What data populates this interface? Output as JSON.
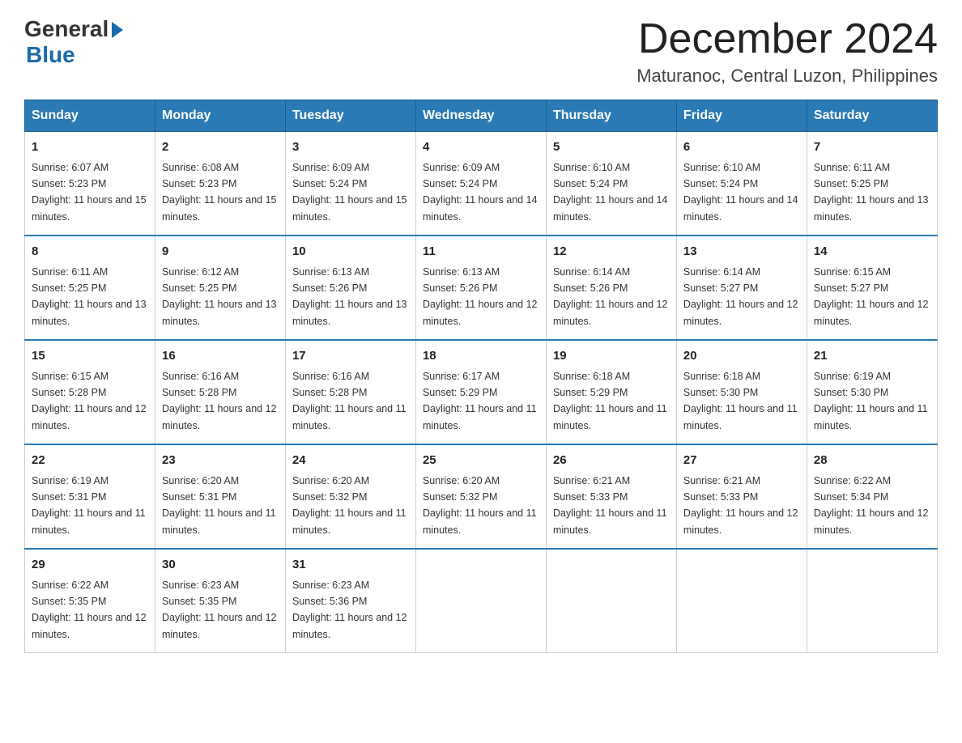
{
  "header": {
    "logo_general": "General",
    "logo_blue": "Blue",
    "month_year": "December 2024",
    "location": "Maturanoc, Central Luzon, Philippines"
  },
  "days_of_week": [
    "Sunday",
    "Monday",
    "Tuesday",
    "Wednesday",
    "Thursday",
    "Friday",
    "Saturday"
  ],
  "weeks": [
    [
      {
        "day": "1",
        "sunrise": "6:07 AM",
        "sunset": "5:23 PM",
        "daylight": "11 hours and 15 minutes."
      },
      {
        "day": "2",
        "sunrise": "6:08 AM",
        "sunset": "5:23 PM",
        "daylight": "11 hours and 15 minutes."
      },
      {
        "day": "3",
        "sunrise": "6:09 AM",
        "sunset": "5:24 PM",
        "daylight": "11 hours and 15 minutes."
      },
      {
        "day": "4",
        "sunrise": "6:09 AM",
        "sunset": "5:24 PM",
        "daylight": "11 hours and 14 minutes."
      },
      {
        "day": "5",
        "sunrise": "6:10 AM",
        "sunset": "5:24 PM",
        "daylight": "11 hours and 14 minutes."
      },
      {
        "day": "6",
        "sunrise": "6:10 AM",
        "sunset": "5:24 PM",
        "daylight": "11 hours and 14 minutes."
      },
      {
        "day": "7",
        "sunrise": "6:11 AM",
        "sunset": "5:25 PM",
        "daylight": "11 hours and 13 minutes."
      }
    ],
    [
      {
        "day": "8",
        "sunrise": "6:11 AM",
        "sunset": "5:25 PM",
        "daylight": "11 hours and 13 minutes."
      },
      {
        "day": "9",
        "sunrise": "6:12 AM",
        "sunset": "5:25 PM",
        "daylight": "11 hours and 13 minutes."
      },
      {
        "day": "10",
        "sunrise": "6:13 AM",
        "sunset": "5:26 PM",
        "daylight": "11 hours and 13 minutes."
      },
      {
        "day": "11",
        "sunrise": "6:13 AM",
        "sunset": "5:26 PM",
        "daylight": "11 hours and 12 minutes."
      },
      {
        "day": "12",
        "sunrise": "6:14 AM",
        "sunset": "5:26 PM",
        "daylight": "11 hours and 12 minutes."
      },
      {
        "day": "13",
        "sunrise": "6:14 AM",
        "sunset": "5:27 PM",
        "daylight": "11 hours and 12 minutes."
      },
      {
        "day": "14",
        "sunrise": "6:15 AM",
        "sunset": "5:27 PM",
        "daylight": "11 hours and 12 minutes."
      }
    ],
    [
      {
        "day": "15",
        "sunrise": "6:15 AM",
        "sunset": "5:28 PM",
        "daylight": "11 hours and 12 minutes."
      },
      {
        "day": "16",
        "sunrise": "6:16 AM",
        "sunset": "5:28 PM",
        "daylight": "11 hours and 12 minutes."
      },
      {
        "day": "17",
        "sunrise": "6:16 AM",
        "sunset": "5:28 PM",
        "daylight": "11 hours and 11 minutes."
      },
      {
        "day": "18",
        "sunrise": "6:17 AM",
        "sunset": "5:29 PM",
        "daylight": "11 hours and 11 minutes."
      },
      {
        "day": "19",
        "sunrise": "6:18 AM",
        "sunset": "5:29 PM",
        "daylight": "11 hours and 11 minutes."
      },
      {
        "day": "20",
        "sunrise": "6:18 AM",
        "sunset": "5:30 PM",
        "daylight": "11 hours and 11 minutes."
      },
      {
        "day": "21",
        "sunrise": "6:19 AM",
        "sunset": "5:30 PM",
        "daylight": "11 hours and 11 minutes."
      }
    ],
    [
      {
        "day": "22",
        "sunrise": "6:19 AM",
        "sunset": "5:31 PM",
        "daylight": "11 hours and 11 minutes."
      },
      {
        "day": "23",
        "sunrise": "6:20 AM",
        "sunset": "5:31 PM",
        "daylight": "11 hours and 11 minutes."
      },
      {
        "day": "24",
        "sunrise": "6:20 AM",
        "sunset": "5:32 PM",
        "daylight": "11 hours and 11 minutes."
      },
      {
        "day": "25",
        "sunrise": "6:20 AM",
        "sunset": "5:32 PM",
        "daylight": "11 hours and 11 minutes."
      },
      {
        "day": "26",
        "sunrise": "6:21 AM",
        "sunset": "5:33 PM",
        "daylight": "11 hours and 11 minutes."
      },
      {
        "day": "27",
        "sunrise": "6:21 AM",
        "sunset": "5:33 PM",
        "daylight": "11 hours and 12 minutes."
      },
      {
        "day": "28",
        "sunrise": "6:22 AM",
        "sunset": "5:34 PM",
        "daylight": "11 hours and 12 minutes."
      }
    ],
    [
      {
        "day": "29",
        "sunrise": "6:22 AM",
        "sunset": "5:35 PM",
        "daylight": "11 hours and 12 minutes."
      },
      {
        "day": "30",
        "sunrise": "6:23 AM",
        "sunset": "5:35 PM",
        "daylight": "11 hours and 12 minutes."
      },
      {
        "day": "31",
        "sunrise": "6:23 AM",
        "sunset": "5:36 PM",
        "daylight": "11 hours and 12 minutes."
      },
      null,
      null,
      null,
      null
    ]
  ]
}
